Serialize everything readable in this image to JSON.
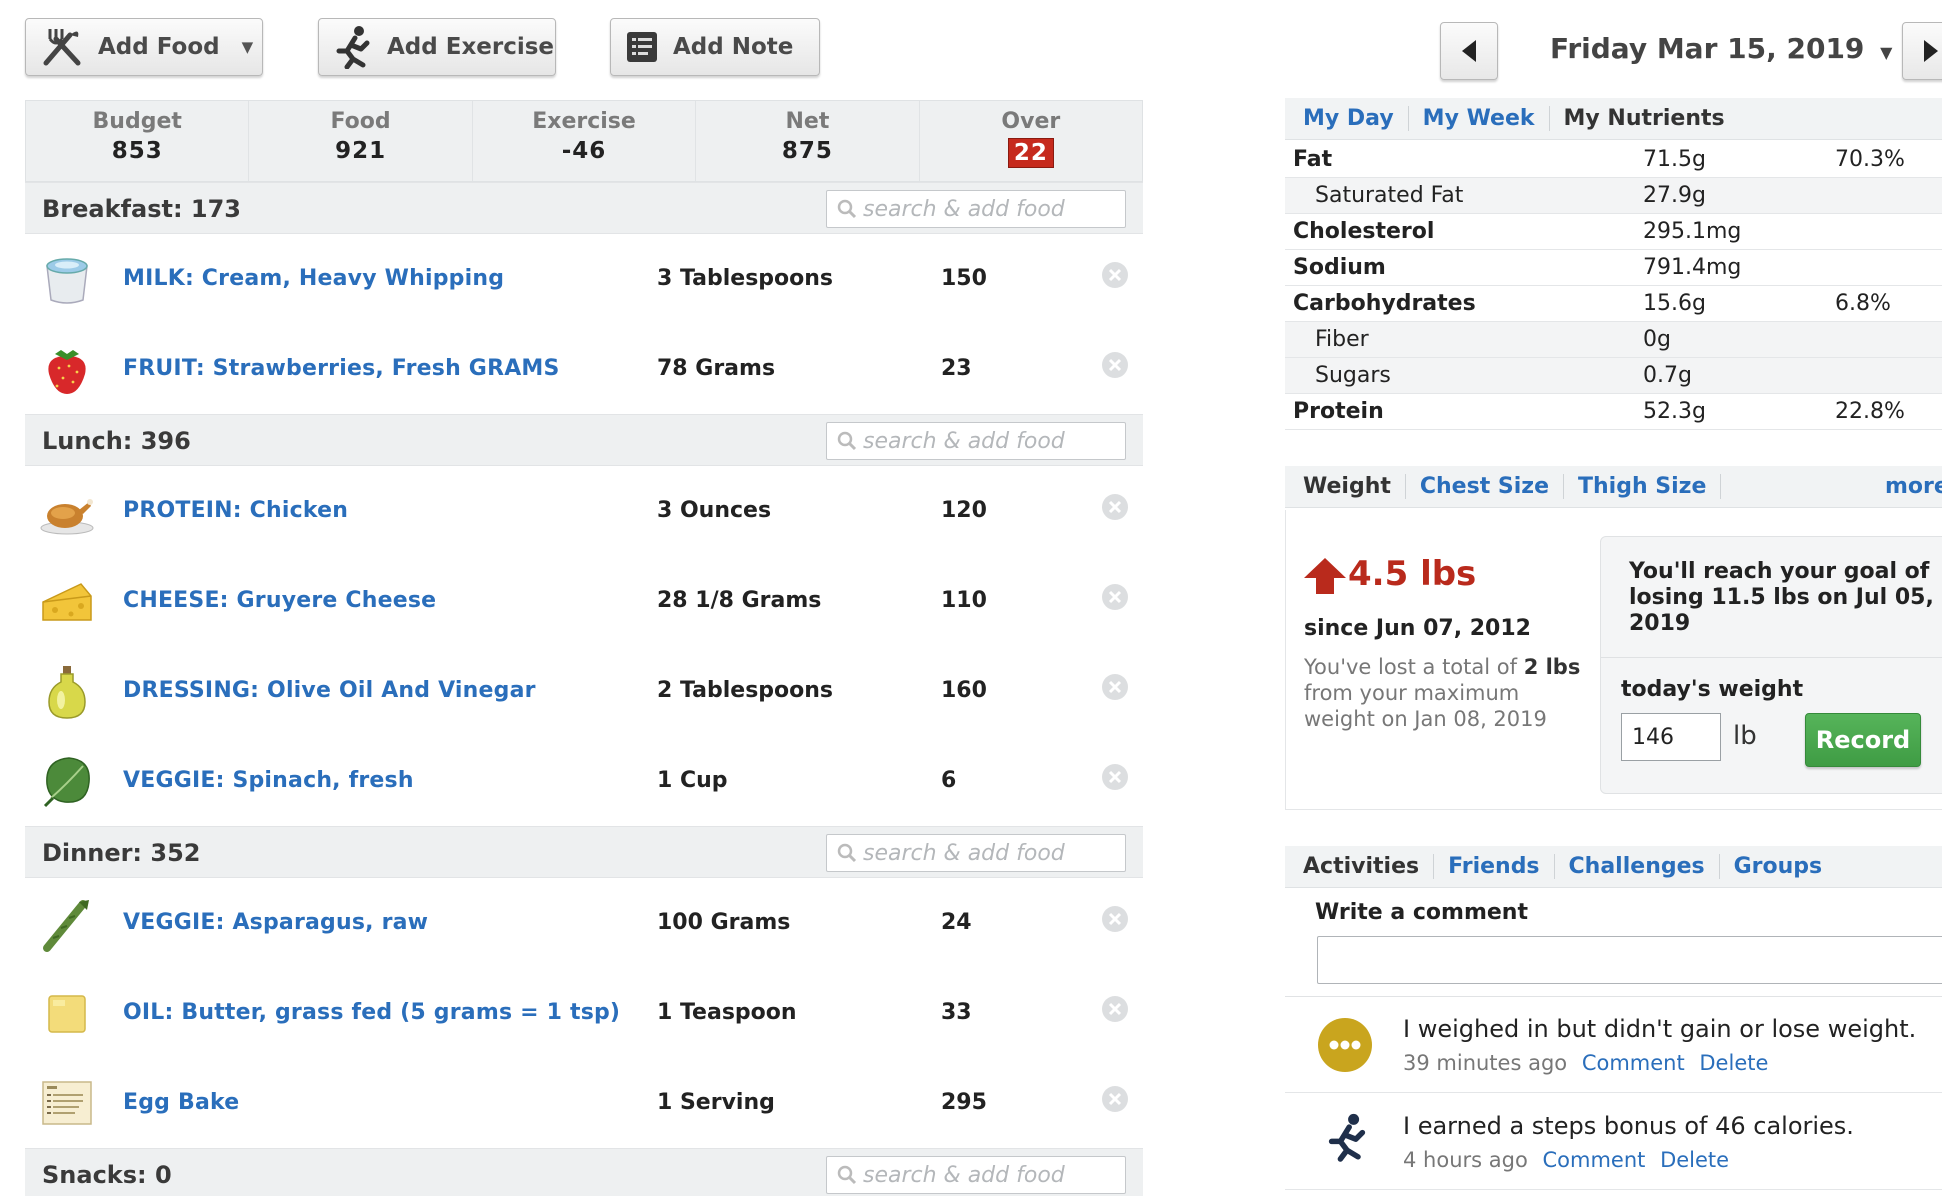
{
  "toolbar": {
    "add_food": "Add Food",
    "add_exercise": "Add Exercise",
    "add_note": "Add Note"
  },
  "summary": {
    "budget_label": "Budget",
    "budget_value": "853",
    "food_label": "Food",
    "food_value": "921",
    "exercise_label": "Exercise",
    "exercise_value": "-46",
    "net_label": "Net",
    "net_value": "875",
    "over_label": "Over",
    "over_value": "22"
  },
  "search_placeholder": "search & add food",
  "meals": {
    "breakfast": {
      "title": "Breakfast: 173",
      "items": [
        {
          "name": "MILK: Cream, Heavy Whipping",
          "amount": "3 Tablespoons",
          "calories": "150"
        },
        {
          "name": "FRUIT: Strawberries, Fresh GRAMS",
          "amount": "78 Grams",
          "calories": "23"
        }
      ]
    },
    "lunch": {
      "title": "Lunch: 396",
      "items": [
        {
          "name": "PROTEIN: Chicken",
          "amount": "3 Ounces",
          "calories": "120"
        },
        {
          "name": "CHEESE: Gruyere Cheese",
          "amount": "28 1/8 Grams",
          "calories": "110"
        },
        {
          "name": "DRESSING: Olive Oil And Vinegar",
          "amount": "2 Tablespoons",
          "calories": "160"
        },
        {
          "name": "VEGGIE: Spinach, fresh",
          "amount": "1 Cup",
          "calories": "6"
        }
      ]
    },
    "dinner": {
      "title": "Dinner: 352",
      "items": [
        {
          "name": "VEGGIE: Asparagus, raw",
          "amount": "100 Grams",
          "calories": "24"
        },
        {
          "name": "OIL: Butter, grass fed (5 grams = 1 tsp)",
          "amount": "1 Teaspoon",
          "calories": "33"
        },
        {
          "name": "Egg Bake",
          "amount": "1 Serving",
          "calories": "295"
        }
      ]
    },
    "snacks": {
      "title": "Snacks: 0"
    }
  },
  "date": {
    "label": "Friday Mar 15, 2019"
  },
  "nutrient_tabs": {
    "my_day": "My Day",
    "my_week": "My Week",
    "my_nutrients": "My Nutrients"
  },
  "nutrients": [
    {
      "name": "Fat",
      "amount": "71.5g",
      "pct": "70.3%"
    },
    {
      "name": "Saturated Fat",
      "amount": "27.9g",
      "pct": ""
    },
    {
      "name": "Cholesterol",
      "amount": "295.1mg",
      "pct": ""
    },
    {
      "name": "Sodium",
      "amount": "791.4mg",
      "pct": ""
    },
    {
      "name": "Carbohydrates",
      "amount": "15.6g",
      "pct": "6.8%"
    },
    {
      "name": "Fiber",
      "amount": "0g",
      "pct": ""
    },
    {
      "name": "Sugars",
      "amount": "0.7g",
      "pct": ""
    },
    {
      "name": "Protein",
      "amount": "52.3g",
      "pct": "22.8%"
    }
  ],
  "weight_tabs": {
    "weight": "Weight",
    "chest": "Chest Size",
    "thigh": "Thigh Size",
    "more": "more"
  },
  "weight": {
    "change": "4.5 lbs",
    "since": "since Jun 07, 2012",
    "lost_prefix": "You've lost a total of ",
    "lost_amount": "2 lbs",
    "lost_line2": "from your maximum",
    "lost_line3": "weight on Jan 08, 2019",
    "goal_line1": "You'll reach your goal of",
    "goal_line2": "losing 11.5 lbs on Jul 05,",
    "goal_line3": "2019",
    "today_label": "today's weight",
    "input_value": "146",
    "unit": "lb",
    "record_button": "Record"
  },
  "activity_tabs": {
    "activities": "Activities",
    "friends": "Friends",
    "challenges": "Challenges",
    "groups": "Groups"
  },
  "activities": {
    "comment_label": "Write a comment",
    "items": [
      {
        "text": "I weighed in but didn't gain or lose weight.",
        "time": "39 minutes ago",
        "comment": "Comment",
        "delete": "Delete"
      },
      {
        "text": "I earned a steps bonus of 46 calories.",
        "time": "4 hours ago",
        "comment": "Comment",
        "delete": "Delete"
      }
    ]
  },
  "colors": {
    "link": "#2a6ebb",
    "over_badge": "#c62a1d",
    "weight_up": "#b92a1c",
    "record": "#45a549"
  }
}
